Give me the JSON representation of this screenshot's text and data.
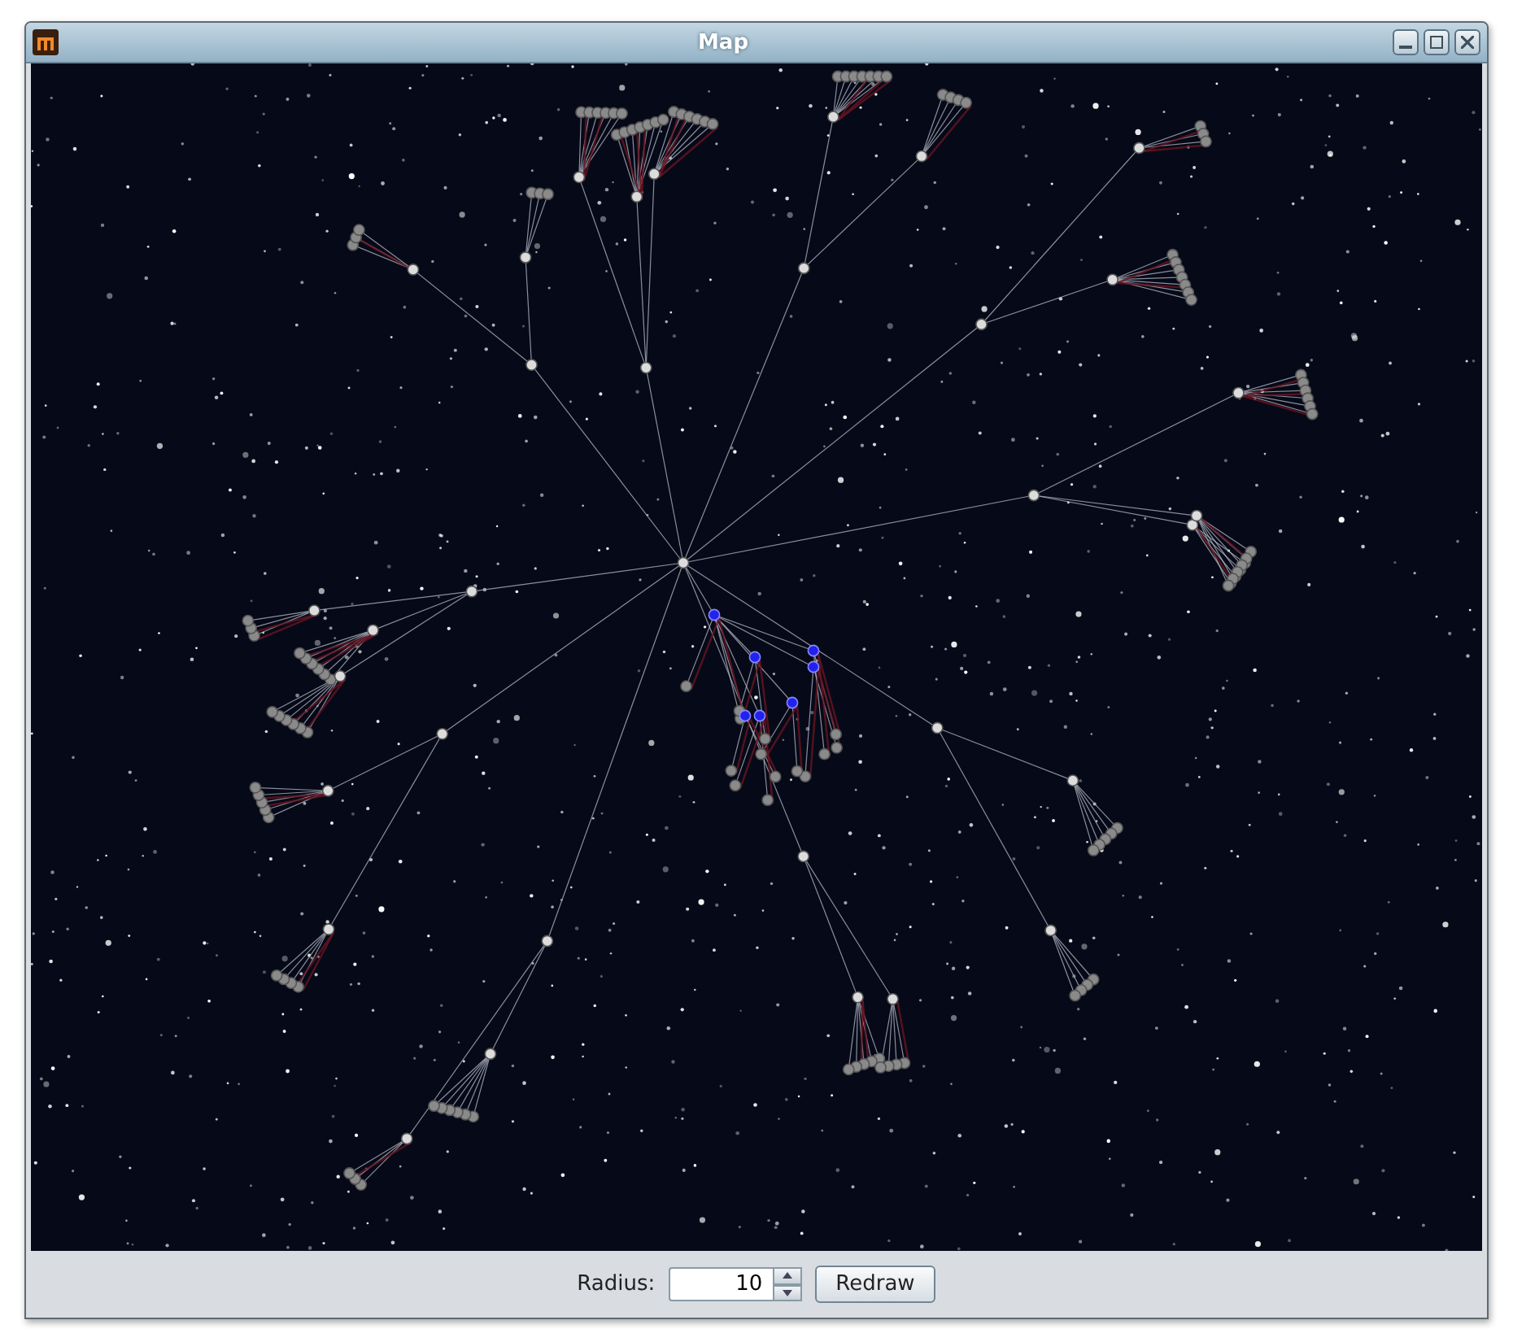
{
  "window": {
    "title": "Map"
  },
  "controls": {
    "radius_label": "Radius:",
    "radius_value": "10",
    "redraw_button": "Redraw"
  }
}
